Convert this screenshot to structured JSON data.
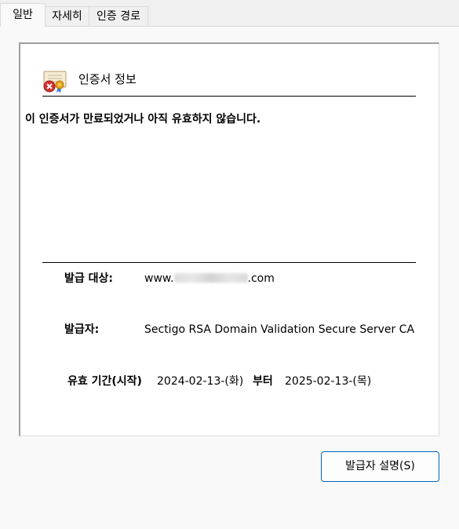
{
  "tabs": [
    {
      "label": "일반",
      "active": true
    },
    {
      "label": "자세히",
      "active": false
    },
    {
      "label": "인증 경로",
      "active": false
    }
  ],
  "certificate": {
    "header_title": "인증서 정보",
    "status_message": "이 인증서가 만료되었거나 아직 유효하지 않습니다.",
    "issued_to_label": "발급 대상:",
    "issued_to_prefix": "www.",
    "issued_to_suffix": ".com",
    "issued_by_label": "발급자:",
    "issued_by_value": "Sectigo RSA Domain Validation Secure Server CA",
    "validity_label": "유효 기간(시작)",
    "valid_from": "2024-02-13-(화)",
    "to_label": "부터",
    "valid_to": "2025-02-13-(목)"
  },
  "buttons": {
    "issuer_statement_label": "발급자 설명(S)"
  },
  "colors": {
    "button_border": "#0067c0",
    "error_badge": "#d32f2f",
    "seal": "#e8a020"
  },
  "icons": {
    "certificate": "certificate-error-icon"
  }
}
